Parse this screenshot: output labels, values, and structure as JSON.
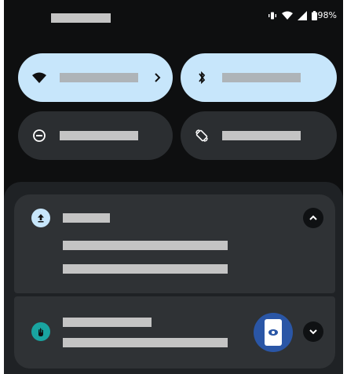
{
  "status_bar": {
    "battery_text": "98%",
    "icons": [
      "vibrate-icon",
      "wifi-icon",
      "cellular-signal-icon",
      "battery-icon"
    ]
  },
  "quick_settings": {
    "tiles": [
      {
        "icon": "wifi-icon",
        "state": "on",
        "has_chevron": true
      },
      {
        "icon": "bluetooth-icon",
        "state": "on",
        "has_chevron": false
      },
      {
        "icon": "do-not-disturb-icon",
        "state": "off",
        "has_chevron": false
      },
      {
        "icon": "auto-rotate-icon",
        "state": "off",
        "has_chevron": false
      }
    ]
  },
  "notifications": [
    {
      "app_icon": "upload-icon",
      "expanded": true,
      "expand_control": "chevron-up-icon"
    },
    {
      "app_icon": "app-badge-icon",
      "expanded": false,
      "expand_control": "chevron-down-icon",
      "thumbnail_icon": "phone-eye-icon"
    }
  ],
  "colors": {
    "background": "#0e0f10",
    "tile_on": "#c7e6fb",
    "tile_off": "#2b2e31",
    "panel": "#1f2225",
    "notification_card": "#2f3235",
    "placeholder_bar": "#c4c4c4",
    "app_icon_accent": "#19a4a0",
    "thumbnail_blue": "#2a56a6"
  }
}
